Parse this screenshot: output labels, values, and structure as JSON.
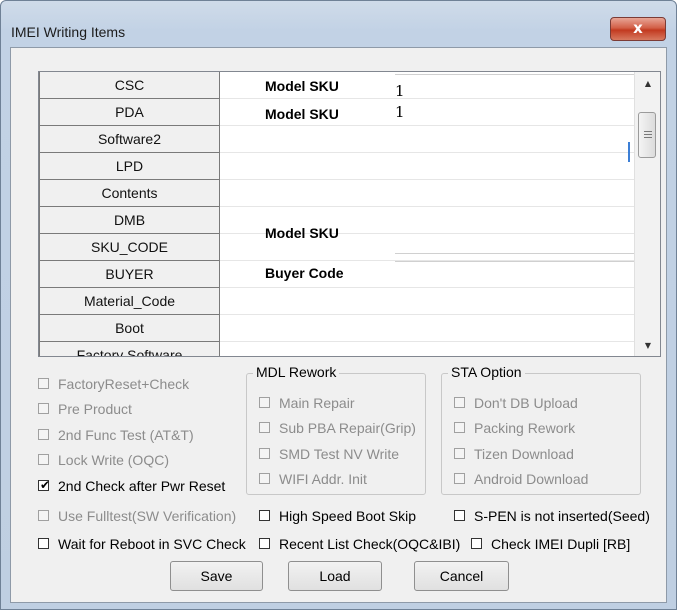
{
  "window": {
    "title": "IMEI Writing Items",
    "close_glyph": "x"
  },
  "list": {
    "rows": [
      {
        "name": "CSC",
        "label": "Model SKU",
        "value": "1"
      },
      {
        "name": "PDA",
        "label": "Model SKU",
        "value": "1"
      },
      {
        "name": "Software2"
      },
      {
        "name": "LPD"
      },
      {
        "name": "Contents"
      },
      {
        "name": "DMB"
      },
      {
        "name": "SKU_CODE",
        "label": "Model SKU"
      },
      {
        "name": "BUYER",
        "label": "Buyer Code"
      },
      {
        "name": "Material_Code"
      },
      {
        "name": "Boot"
      },
      {
        "name": "Factory Software"
      }
    ]
  },
  "left_options": [
    {
      "label": "FactoryReset+Check",
      "checked": false,
      "enabled": false
    },
    {
      "label": "Pre Product",
      "checked": false,
      "enabled": false
    },
    {
      "label": "2nd Func Test (AT&T)",
      "checked": false,
      "enabled": false
    },
    {
      "label": "Lock Write (OQC)",
      "checked": false,
      "enabled": false
    },
    {
      "label": "2nd Check after Pwr Reset",
      "checked": true,
      "enabled": true
    }
  ],
  "mdl_rework": {
    "title": "MDL Rework",
    "items": [
      {
        "label": "Main Repair",
        "checked": false,
        "enabled": false
      },
      {
        "label": "Sub PBA Repair(Grip)",
        "checked": false,
        "enabled": false
      },
      {
        "label": "SMD Test NV Write",
        "checked": false,
        "enabled": false
      },
      {
        "label": "WIFI Addr. Init",
        "checked": false,
        "enabled": false
      }
    ]
  },
  "sta_option": {
    "title": "STA Option",
    "items": [
      {
        "label": "Don't DB Upload",
        "checked": false,
        "enabled": false
      },
      {
        "label": "Packing Rework",
        "checked": false,
        "enabled": false
      },
      {
        "label": "Tizen Download",
        "checked": false,
        "enabled": false
      },
      {
        "label": "Android Download",
        "checked": false,
        "enabled": false
      }
    ]
  },
  "bottom_options": {
    "fulltest": {
      "label": "Use Fulltest(SW Verification)",
      "checked": false,
      "enabled": false
    },
    "high_speed_boot_skip": {
      "label": "High Speed Boot Skip",
      "checked": false,
      "enabled": true
    },
    "spen": {
      "label": "S-PEN is not inserted(Seed)",
      "checked": false,
      "enabled": true
    },
    "wait_reboot": {
      "label": "Wait for Reboot in SVC Check",
      "checked": false,
      "enabled": true
    },
    "recent_list": {
      "label": "Recent List Check(OQC&IBI)",
      "checked": false,
      "enabled": true
    },
    "imei_dupli": {
      "label": "Check IMEI Dupli [RB]",
      "checked": false,
      "enabled": true
    }
  },
  "buttons": {
    "save": "Save",
    "load": "Load",
    "cancel": "Cancel"
  },
  "check_glyph": "✔"
}
